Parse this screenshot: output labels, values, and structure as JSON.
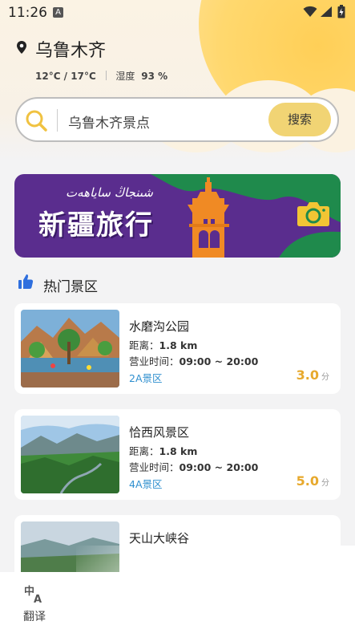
{
  "status_bar": {
    "time": "11:26",
    "notification_icon": "A"
  },
  "location": {
    "city": "乌鲁木齐",
    "temperature": "12°C / 17°C",
    "humidity_label": "湿度",
    "humidity_value": "93 %"
  },
  "search": {
    "placeholder": "乌鲁木齐景点",
    "button_label": "搜索"
  },
  "banner": {
    "title": "新疆旅行",
    "subtitle": "شىنجاڭ ساياھەت"
  },
  "section": {
    "title": "热门景区",
    "icon": "thumbs-up-icon"
  },
  "spots": [
    {
      "name": "水磨沟公园",
      "distance_label": "距离：",
      "distance": "1.8 km",
      "hours_label": "营业时间：",
      "hours": "09:00 ~ 20:00",
      "level": "2A景区",
      "score": "3.0",
      "score_unit": "分"
    },
    {
      "name": "恰西风景区",
      "distance_label": "距离：",
      "distance": "1.8 km",
      "hours_label": "营业时间：",
      "hours": "09:00 ~ 20:00",
      "level": "4A景区",
      "score": "5.0",
      "score_unit": "分"
    },
    {
      "name": "天山大峡谷"
    }
  ],
  "bottom_nav": {
    "translate_label": "翻译",
    "translate_icon": "translate-icon"
  },
  "colors": {
    "accent_yellow": "#f1d474",
    "score": "#e7a92d",
    "level_blue": "#2f8fcf",
    "banner_purple": "#5a2d8e",
    "banner_orange": "#f08a24",
    "banner_green": "#1f8a4c"
  }
}
